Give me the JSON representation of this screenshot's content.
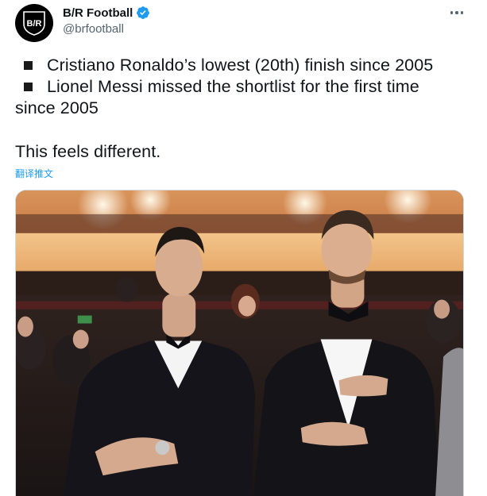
{
  "account": {
    "avatar_text": "B/R",
    "display_name": "B/R Football",
    "handle": "@brfootball",
    "verified": true
  },
  "tweet": {
    "lines": [
      "Cristiano Ronaldo’s lowest (20th) finish since 2005",
      "Lionel Messi missed the shortlist for the first time",
      "since 2005",
      "This feels different."
    ],
    "translate_label": "翻译推文"
  },
  "icons": {
    "more": "more-horizontal-icon",
    "verified": "verified-badge-icon",
    "bullet": "black-square-bullet-icon"
  },
  "colors": {
    "link": "#1d9bf0",
    "verified": "#1d9bf0",
    "secondary_text": "#536471"
  },
  "media": {
    "description_icon": "photo"
  }
}
